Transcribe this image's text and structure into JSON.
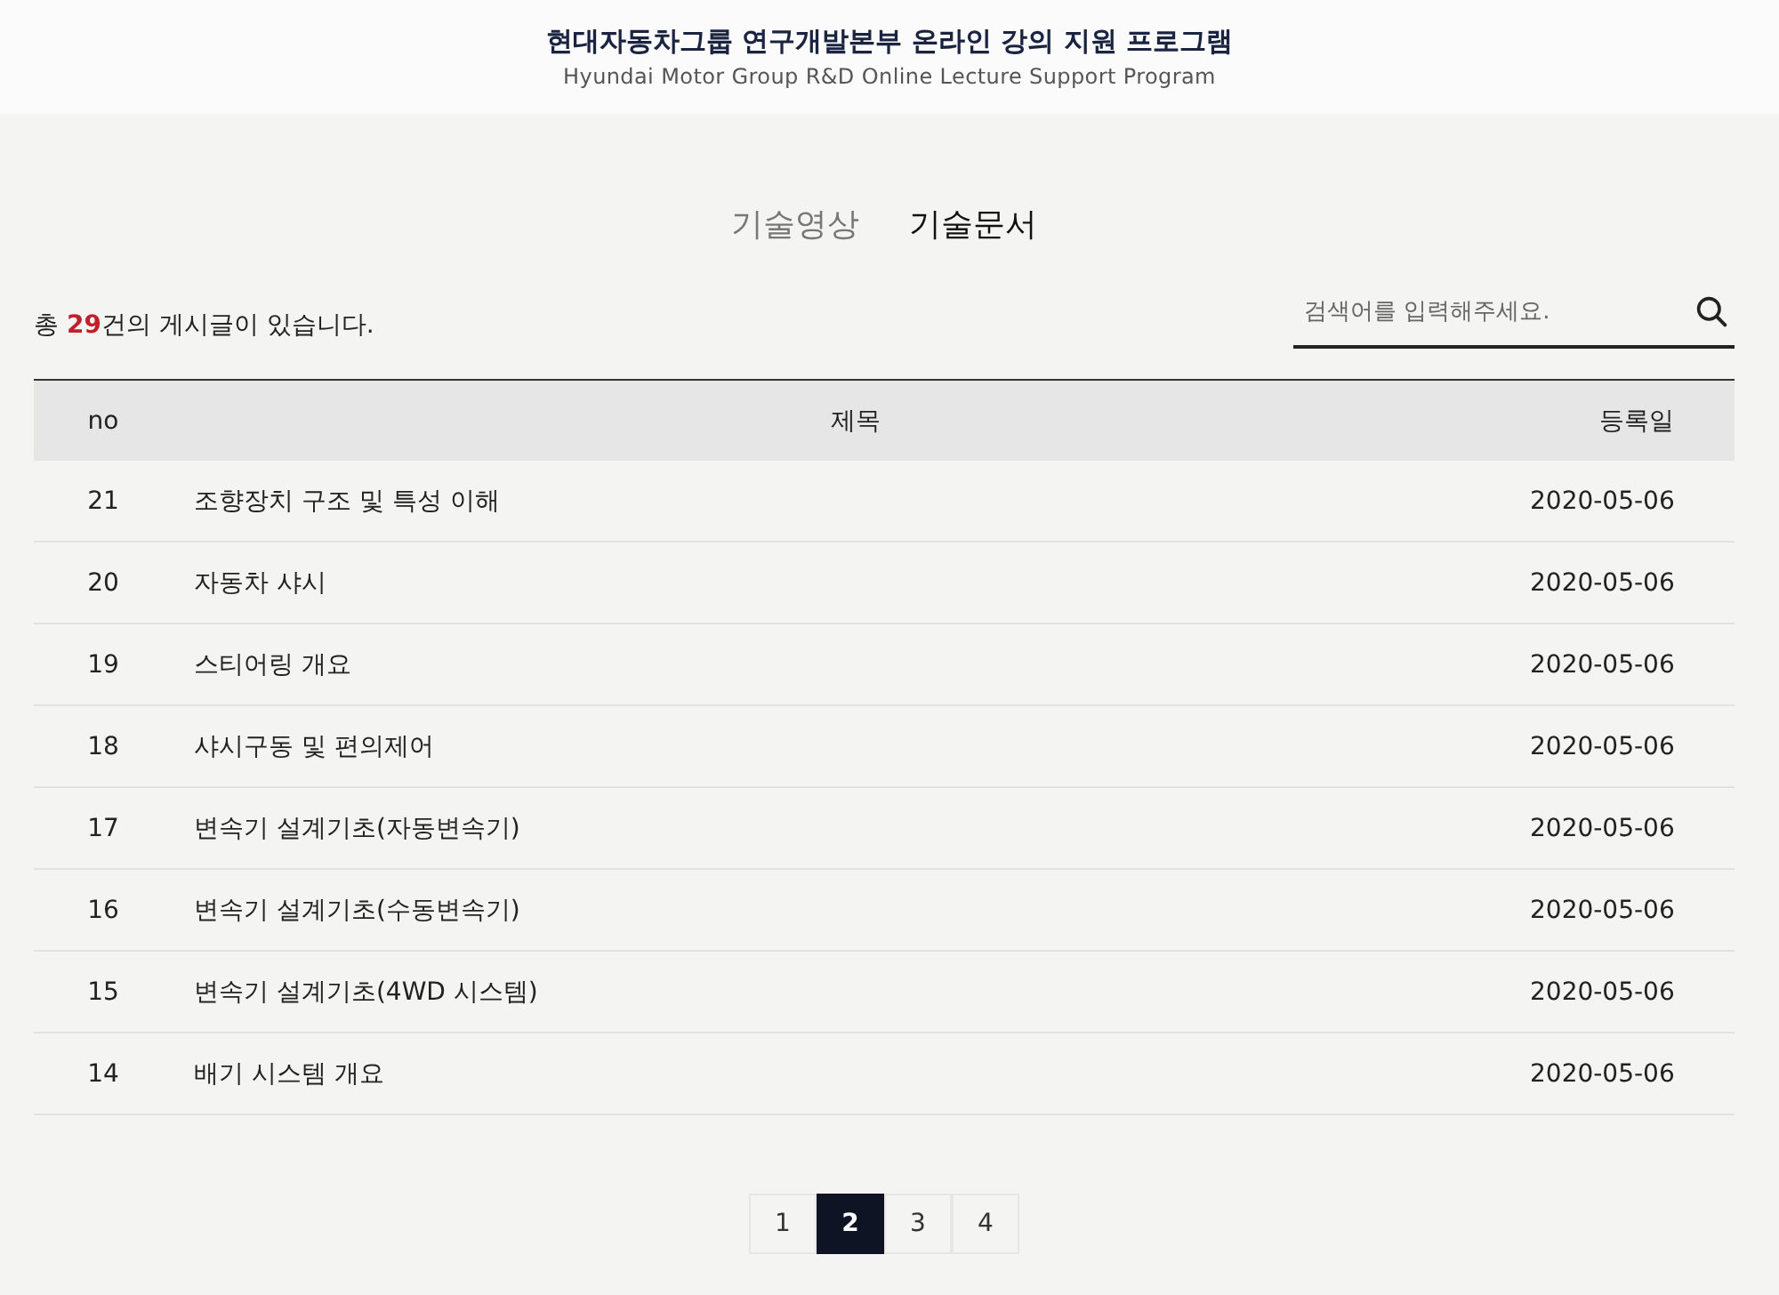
{
  "header": {
    "title": "현대자동차그룹 연구개발본부 온라인 강의 지원 프로그램",
    "subtitle": "Hyundai Motor Group R&D Online Lecture Support Program"
  },
  "tabs": [
    {
      "label": "기술영상",
      "selected": false
    },
    {
      "label": "기술문서",
      "selected": true
    }
  ],
  "summary": {
    "before": "총 ",
    "count": "29",
    "after": "건의 게시글이 있습니다."
  },
  "search": {
    "placeholder": "검색어를 입력해주세요."
  },
  "table": {
    "columns": [
      "no",
      "제목",
      "등록일"
    ],
    "rows": [
      [
        "21",
        "조향장치 구조 및 특성 이해",
        "2020-05-06"
      ],
      [
        "20",
        "자동차 샤시",
        "2020-05-06"
      ],
      [
        "19",
        "스티어링 개요",
        "2020-05-06"
      ],
      [
        "18",
        "샤시구동 및 편의제어",
        "2020-05-06"
      ],
      [
        "17",
        "변속기 설계기초(자동변속기)",
        "2020-05-06"
      ],
      [
        "16",
        "변속기 설계기초(수동변속기)",
        "2020-05-06"
      ],
      [
        "15",
        "변속기 설계기초(4WD 시스템)",
        "2020-05-06"
      ],
      [
        "14",
        "배기 시스템 개요",
        "2020-05-06"
      ]
    ]
  },
  "pagination": [
    {
      "label": "1",
      "selected": false
    },
    {
      "label": "2",
      "selected": true
    },
    {
      "label": "3",
      "selected": false
    },
    {
      "label": "4",
      "selected": false
    }
  ]
}
